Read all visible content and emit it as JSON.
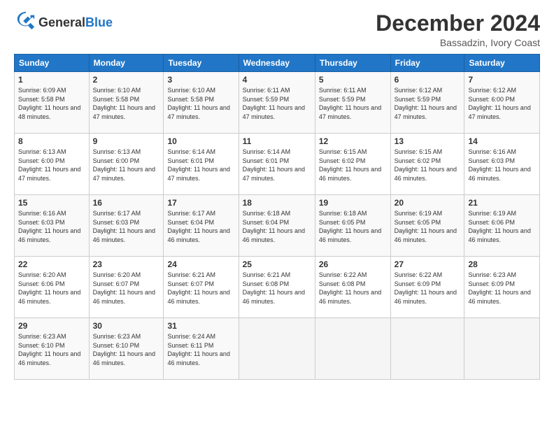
{
  "logo": {
    "general": "General",
    "blue": "Blue"
  },
  "header": {
    "month_title": "December 2024",
    "location": "Bassadzin, Ivory Coast"
  },
  "weekdays": [
    "Sunday",
    "Monday",
    "Tuesday",
    "Wednesday",
    "Thursday",
    "Friday",
    "Saturday"
  ],
  "weeks": [
    [
      {
        "day": "1",
        "sunrise": "6:09 AM",
        "sunset": "5:58 PM",
        "daylight": "11 hours and 48 minutes."
      },
      {
        "day": "2",
        "sunrise": "6:10 AM",
        "sunset": "5:58 PM",
        "daylight": "11 hours and 47 minutes."
      },
      {
        "day": "3",
        "sunrise": "6:10 AM",
        "sunset": "5:58 PM",
        "daylight": "11 hours and 47 minutes."
      },
      {
        "day": "4",
        "sunrise": "6:11 AM",
        "sunset": "5:59 PM",
        "daylight": "11 hours and 47 minutes."
      },
      {
        "day": "5",
        "sunrise": "6:11 AM",
        "sunset": "5:59 PM",
        "daylight": "11 hours and 47 minutes."
      },
      {
        "day": "6",
        "sunrise": "6:12 AM",
        "sunset": "5:59 PM",
        "daylight": "11 hours and 47 minutes."
      },
      {
        "day": "7",
        "sunrise": "6:12 AM",
        "sunset": "6:00 PM",
        "daylight": "11 hours and 47 minutes."
      }
    ],
    [
      {
        "day": "8",
        "sunrise": "6:13 AM",
        "sunset": "6:00 PM",
        "daylight": "11 hours and 47 minutes."
      },
      {
        "day": "9",
        "sunrise": "6:13 AM",
        "sunset": "6:00 PM",
        "daylight": "11 hours and 47 minutes."
      },
      {
        "day": "10",
        "sunrise": "6:14 AM",
        "sunset": "6:01 PM",
        "daylight": "11 hours and 47 minutes."
      },
      {
        "day": "11",
        "sunrise": "6:14 AM",
        "sunset": "6:01 PM",
        "daylight": "11 hours and 47 minutes."
      },
      {
        "day": "12",
        "sunrise": "6:15 AM",
        "sunset": "6:02 PM",
        "daylight": "11 hours and 46 minutes."
      },
      {
        "day": "13",
        "sunrise": "6:15 AM",
        "sunset": "6:02 PM",
        "daylight": "11 hours and 46 minutes."
      },
      {
        "day": "14",
        "sunrise": "6:16 AM",
        "sunset": "6:03 PM",
        "daylight": "11 hours and 46 minutes."
      }
    ],
    [
      {
        "day": "15",
        "sunrise": "6:16 AM",
        "sunset": "6:03 PM",
        "daylight": "11 hours and 46 minutes."
      },
      {
        "day": "16",
        "sunrise": "6:17 AM",
        "sunset": "6:03 PM",
        "daylight": "11 hours and 46 minutes."
      },
      {
        "day": "17",
        "sunrise": "6:17 AM",
        "sunset": "6:04 PM",
        "daylight": "11 hours and 46 minutes."
      },
      {
        "day": "18",
        "sunrise": "6:18 AM",
        "sunset": "6:04 PM",
        "daylight": "11 hours and 46 minutes."
      },
      {
        "day": "19",
        "sunrise": "6:18 AM",
        "sunset": "6:05 PM",
        "daylight": "11 hours and 46 minutes."
      },
      {
        "day": "20",
        "sunrise": "6:19 AM",
        "sunset": "6:05 PM",
        "daylight": "11 hours and 46 minutes."
      },
      {
        "day": "21",
        "sunrise": "6:19 AM",
        "sunset": "6:06 PM",
        "daylight": "11 hours and 46 minutes."
      }
    ],
    [
      {
        "day": "22",
        "sunrise": "6:20 AM",
        "sunset": "6:06 PM",
        "daylight": "11 hours and 46 minutes."
      },
      {
        "day": "23",
        "sunrise": "6:20 AM",
        "sunset": "6:07 PM",
        "daylight": "11 hours and 46 minutes."
      },
      {
        "day": "24",
        "sunrise": "6:21 AM",
        "sunset": "6:07 PM",
        "daylight": "11 hours and 46 minutes."
      },
      {
        "day": "25",
        "sunrise": "6:21 AM",
        "sunset": "6:08 PM",
        "daylight": "11 hours and 46 minutes."
      },
      {
        "day": "26",
        "sunrise": "6:22 AM",
        "sunset": "6:08 PM",
        "daylight": "11 hours and 46 minutes."
      },
      {
        "day": "27",
        "sunrise": "6:22 AM",
        "sunset": "6:09 PM",
        "daylight": "11 hours and 46 minutes."
      },
      {
        "day": "28",
        "sunrise": "6:23 AM",
        "sunset": "6:09 PM",
        "daylight": "11 hours and 46 minutes."
      }
    ],
    [
      {
        "day": "29",
        "sunrise": "6:23 AM",
        "sunset": "6:10 PM",
        "daylight": "11 hours and 46 minutes."
      },
      {
        "day": "30",
        "sunrise": "6:23 AM",
        "sunset": "6:10 PM",
        "daylight": "11 hours and 46 minutes."
      },
      {
        "day": "31",
        "sunrise": "6:24 AM",
        "sunset": "6:11 PM",
        "daylight": "11 hours and 46 minutes."
      },
      null,
      null,
      null,
      null
    ]
  ],
  "labels": {
    "sunrise_prefix": "Sunrise: ",
    "sunset_prefix": "Sunset: ",
    "daylight_prefix": "Daylight: "
  }
}
